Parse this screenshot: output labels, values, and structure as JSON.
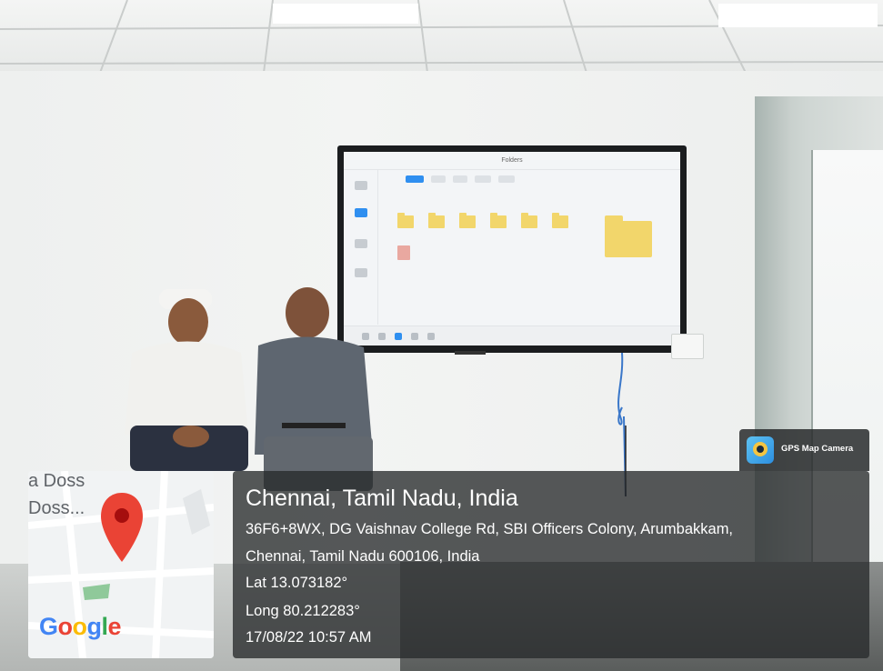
{
  "tv": {
    "window_title": "Folders"
  },
  "map": {
    "street_label_1": "a Doss",
    "street_label_2": "Doss...",
    "google_logo": "Google",
    "pin_color": "#ea4335"
  },
  "location": {
    "title": "Chennai, Tamil Nadu, India",
    "address_line_1": "36F6+8WX, DG Vaishnav College Rd, SBI Officers Colony, Arumbakkam,",
    "address_line_2": "Chennai, Tamil Nadu 600106, India",
    "latitude": "Lat 13.073182°",
    "longitude": "Long 80.212283°",
    "timestamp": "17/08/22 10:57 AM"
  },
  "badge": {
    "label": "GPS Map Camera",
    "icon": "gps-map-camera-icon"
  },
  "colors": {
    "overlay_bg": "#2a2c2e",
    "accent_blue": "#2f8ff0",
    "folder_yellow": "#f2d66b"
  }
}
